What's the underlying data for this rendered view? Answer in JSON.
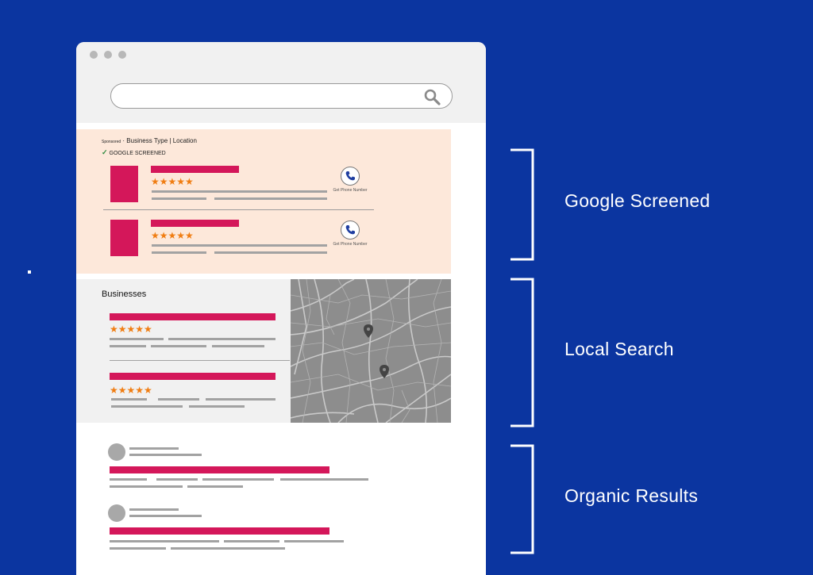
{
  "search": {
    "icon": "search-icon"
  },
  "sponsored": {
    "tag": "Sponsored",
    "heading": " · Business Type | Location",
    "screened_badge": "GOOGLE SCREENED",
    "phone_label": "Get Phone Number",
    "phone_icon": "phone-icon",
    "stars": "★★★★★"
  },
  "local": {
    "title": "Businesses",
    "stars": "★★★★★",
    "map_pin_icon": "map-pin-icon"
  },
  "labels": {
    "google_screened": "Google Screened",
    "local_search": "Local Search",
    "organic_results": "Organic Results"
  },
  "colors": {
    "background": "#0b35a0",
    "accent_red": "#d4175a",
    "star_orange": "#f07d12",
    "sponsored_bg": "#fde8da",
    "panel_gray": "#f1f1f1"
  }
}
